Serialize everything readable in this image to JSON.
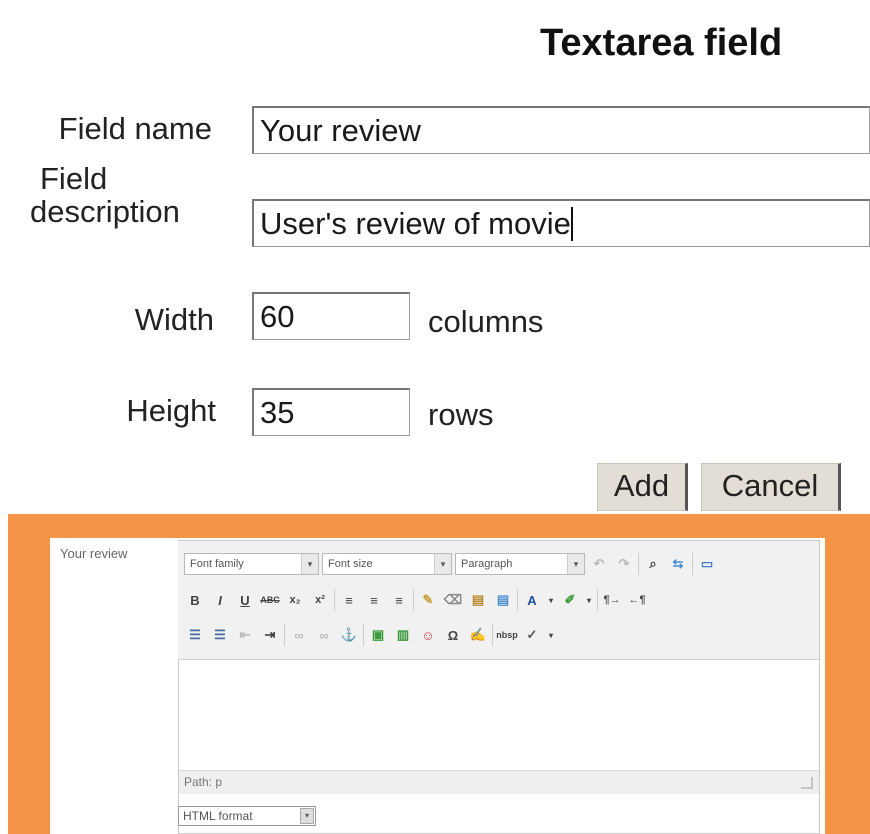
{
  "form": {
    "title": "Textarea field",
    "field_name": {
      "label": "Field name",
      "value": "Your review"
    },
    "field_description": {
      "label_line1": "Field",
      "label_line2": "description",
      "value": "User's review of movie"
    },
    "width": {
      "label": "Width",
      "value": "60",
      "unit": "columns"
    },
    "height": {
      "label": "Height",
      "value": "35",
      "unit": "rows"
    },
    "buttons": {
      "add": "Add",
      "cancel": "Cancel"
    }
  },
  "preview": {
    "label": "Your review",
    "toolbar": {
      "font_family": "Font family",
      "font_size": "Font size",
      "paragraph": "Paragraph"
    },
    "path": "Path: p",
    "format": "HTML format",
    "accent_color": "#f39447"
  }
}
